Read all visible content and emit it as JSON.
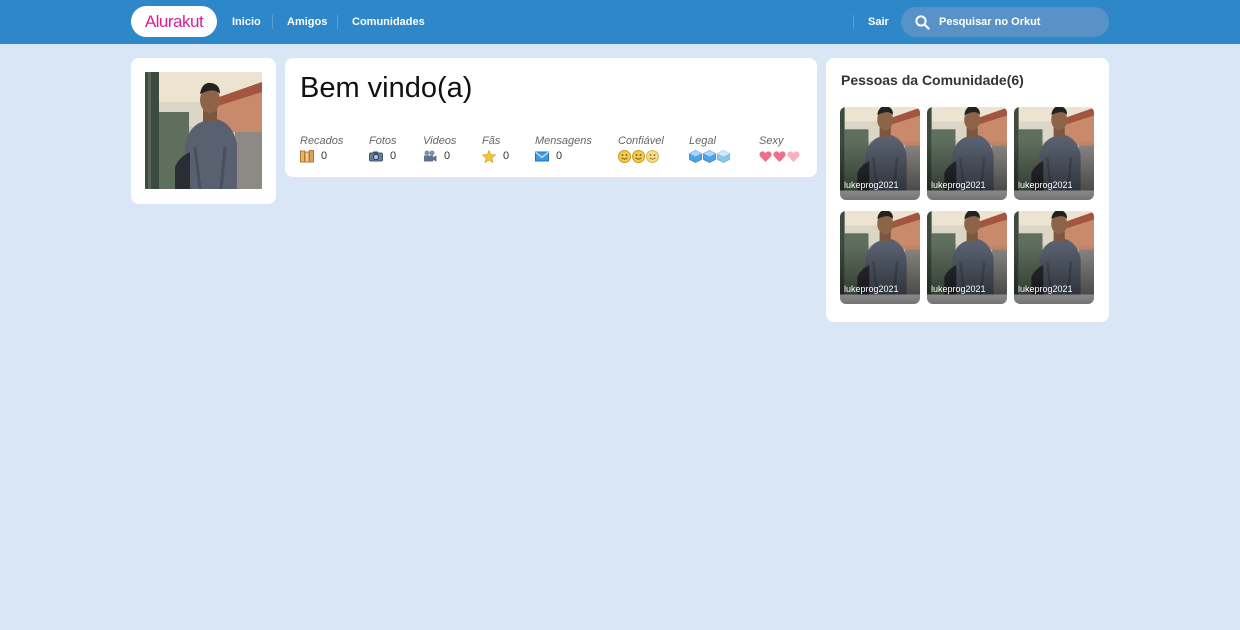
{
  "app": {
    "logo_text": "Alurakut",
    "brand_color": "#d81d99",
    "header_color": "#2e87c8"
  },
  "nav": {
    "home": "Inicio",
    "friends": "Amigos",
    "communities": "Comunidades",
    "logout": "Sair"
  },
  "search": {
    "placeholder": "Pesquisar no Orkut",
    "icon": "search-icon"
  },
  "welcome": {
    "title": "Bem vindo(a)",
    "stats": [
      {
        "label": "Recados",
        "icon": "scrap-book-icon",
        "value": "0"
      },
      {
        "label": "Fotos",
        "icon": "camera-icon",
        "value": "0"
      },
      {
        "label": "Videos",
        "icon": "video-camera-icon",
        "value": "0"
      },
      {
        "label": "Fãs",
        "icon": "star-icon",
        "value": "0"
      },
      {
        "label": "Mensagens",
        "icon": "envelope-icon",
        "value": "0"
      },
      {
        "label": "Confiável",
        "icon": "smiley-icon",
        "level": "3/3"
      },
      {
        "label": "Legal",
        "icon": "ice-cube-icon",
        "level": "3/3"
      },
      {
        "label": "Sexy",
        "icon": "heart-icon",
        "level": "3/3"
      }
    ]
  },
  "community": {
    "title": "Pessoas da Comunidade(6)",
    "members": [
      {
        "name": "lukeprog2021"
      },
      {
        "name": "lukeprog2021"
      },
      {
        "name": "lukeprog2021"
      },
      {
        "name": "lukeprog2021"
      },
      {
        "name": "lukeprog2021"
      },
      {
        "name": "lukeprog2021"
      }
    ]
  }
}
